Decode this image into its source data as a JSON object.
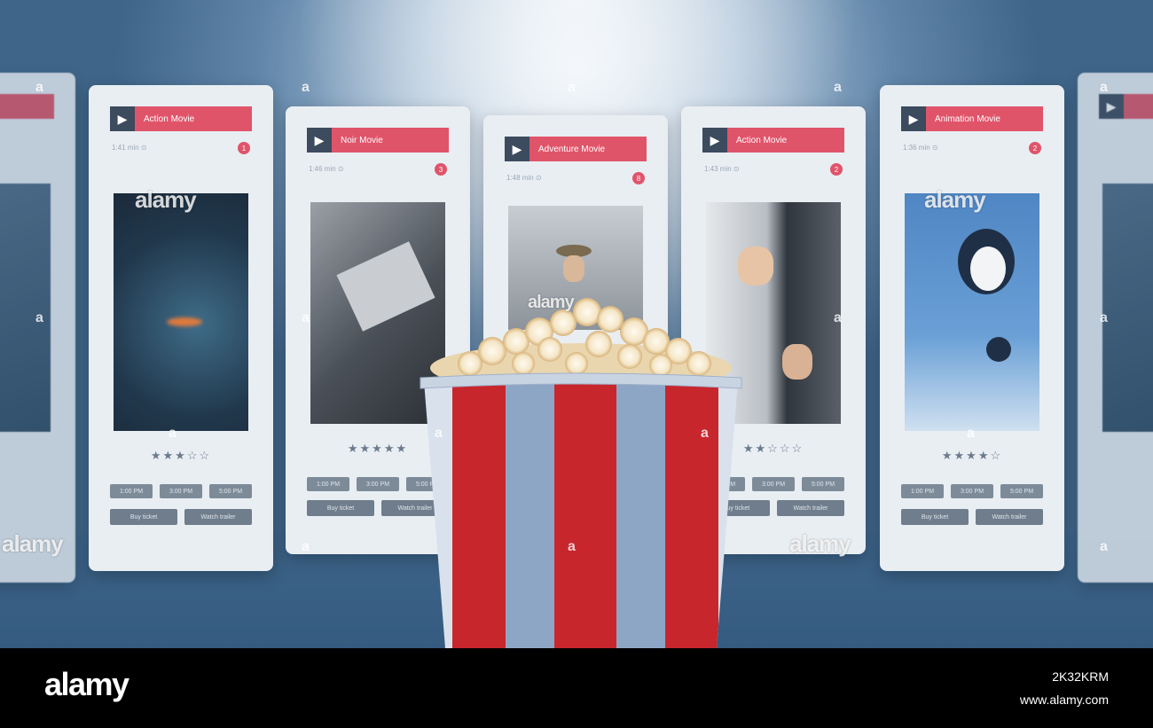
{
  "cards": [
    {
      "title": "",
      "stars": "",
      "far": true
    },
    {
      "title": "Action Movie",
      "stars": "★★★☆☆",
      "num": "1",
      "meta": "1:41 min   ⊙"
    },
    {
      "title": "Noir Movie",
      "stars": "★★★★★",
      "num": "3",
      "meta": "1:46 min   ⊙"
    },
    {
      "title": "Adventure Movie",
      "stars": "",
      "num": "8",
      "meta": "1:48 min   ⊙"
    },
    {
      "title": "Action Movie",
      "stars": "★★☆☆☆",
      "num": "2",
      "meta": "1:43 min   ⊙"
    },
    {
      "title": "Animation Movie",
      "stars": "★★★★☆",
      "num": "2",
      "meta": "1:36 min   ⊙"
    },
    {
      "title": "",
      "stars": "",
      "far": true
    }
  ],
  "buttons": {
    "row1": [
      "1:00 PM",
      "3:00 PM",
      "5:00 PM"
    ],
    "row2": [
      "Buy ticket",
      "Watch trailer"
    ]
  },
  "watermark": {
    "text": "alamy",
    "marker": "a"
  },
  "footer": {
    "logo": "alamy",
    "image_id": "2K32KRM",
    "url": "www.alamy.com"
  },
  "colors": {
    "header_red": "#e0546a",
    "bucket_red": "#c8262d",
    "bucket_blue": "#8ea6c6"
  }
}
